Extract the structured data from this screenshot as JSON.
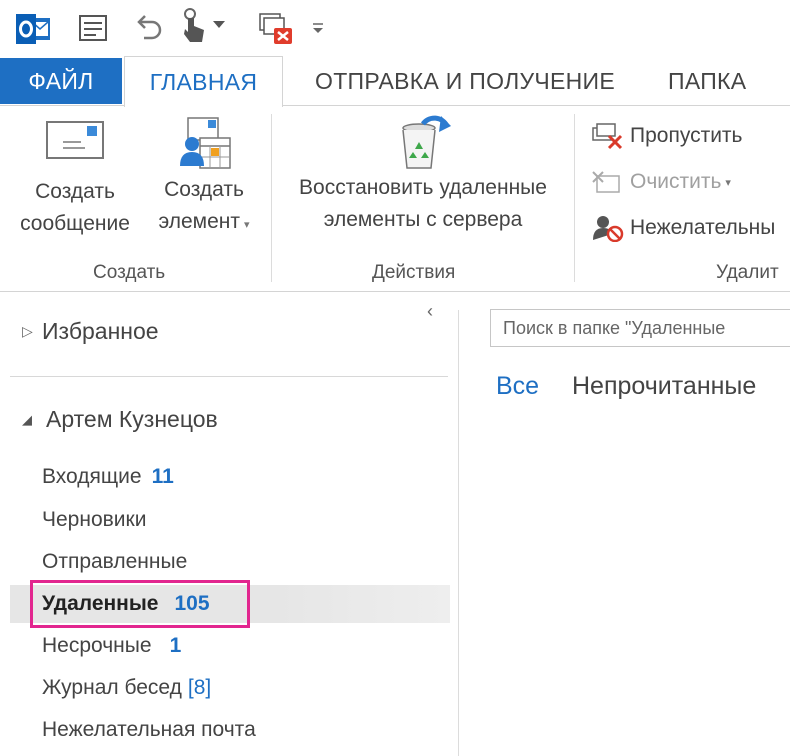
{
  "quick_access": {
    "icons": [
      "outlook-logo",
      "message-list-icon",
      "undo-icon",
      "touch-mode-icon",
      "dropdown-arrow",
      "empty-deleted-icon",
      "customize-qat-icon"
    ]
  },
  "tabs": {
    "file": "ФАЙЛ",
    "home": "ГЛАВНАЯ",
    "send_receive": "ОТПРАВКА И ПОЛУЧЕНИЕ",
    "folder": "ПАПКА"
  },
  "ribbon": {
    "new_message": {
      "line1": "Создать",
      "line2": "сообщение"
    },
    "new_item": {
      "line1": "Создать",
      "line2": "элемент"
    },
    "restore": {
      "line1": "Восстановить удаленные",
      "line2": "элементы с сервера"
    },
    "groups": {
      "create": "Создать",
      "actions": "Действия",
      "delete": "Удалит"
    },
    "ignore": "Пропустить",
    "clean_up": "Очистить",
    "junk": "Нежелательны"
  },
  "folder_pane": {
    "favorites": "Избранное",
    "account": "Артем Кузнецов",
    "folders": {
      "inbox": {
        "label": "Входящие",
        "count": "11"
      },
      "drafts": {
        "label": "Черновики"
      },
      "sent": {
        "label": "Отправленные"
      },
      "deleted": {
        "label": "Удаленные",
        "count": "105"
      },
      "clutter": {
        "label": "Несрочные",
        "count": "1"
      },
      "history": {
        "label": "Журнал бесед",
        "count": "[8]"
      },
      "junk": {
        "label": "Нежелательная почта"
      }
    }
  },
  "message_list": {
    "search_placeholder": "Поиск в папке \"Удаленные",
    "filter_all": "Все",
    "filter_unread": "Непрочитанные"
  },
  "colors": {
    "accent": "#1e6fc3",
    "highlight": "#e2268f"
  }
}
